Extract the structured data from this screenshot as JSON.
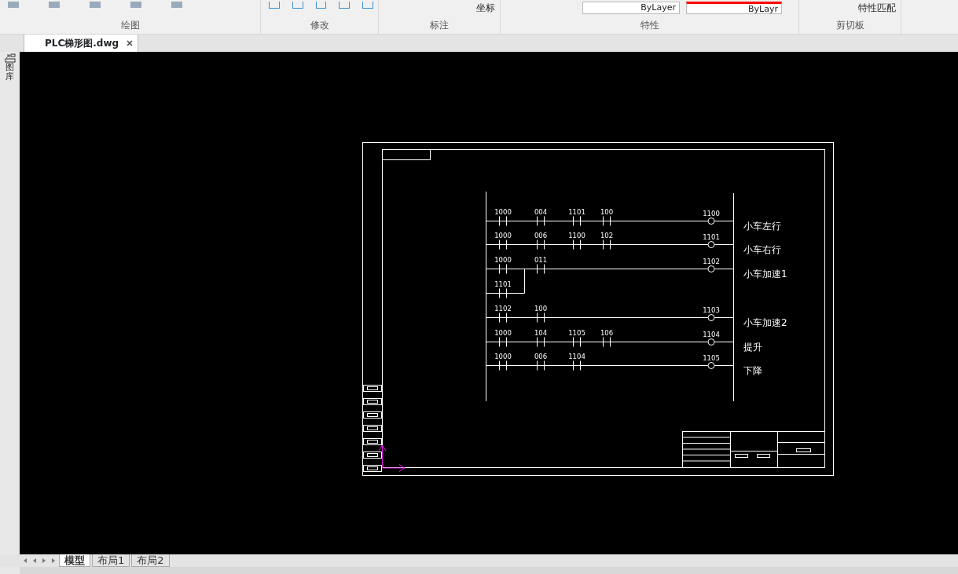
{
  "ribbon": {
    "partial_texts": [
      {
        "kind": "dropdown",
        "text": "坐标"
      },
      {
        "kind": "combo",
        "text": "ByLayer"
      },
      {
        "kind": "color_combo",
        "text": "ByLayr"
      },
      {
        "kind": "tool",
        "text": "特性匹配"
      }
    ],
    "groups": [
      "绘图",
      "修改",
      "标注",
      "特性",
      "剪切板"
    ]
  },
  "file_tabs": [
    {
      "label": "PLC梯形图.dwg",
      "selected": true
    }
  ],
  "side_panel": {
    "label": "图库"
  },
  "drawing": {
    "rungs": [
      {
        "contacts": [
          "1000",
          "004",
          "1101",
          "100"
        ],
        "coil": "1100",
        "name": "小车左行"
      },
      {
        "contacts": [
          "1000",
          "006",
          "1100",
          "102"
        ],
        "coil": "1101",
        "name": "小车右行"
      },
      {
        "contacts": [
          "1000",
          "011"
        ],
        "branch": "1101",
        "coil": "1102",
        "name": "小车加速1"
      },
      {
        "contacts": [
          "1102",
          "100"
        ],
        "coil": "1103",
        "name": "小车加速2"
      },
      {
        "contacts": [
          "1000",
          "104",
          "1105",
          "106"
        ],
        "coil": "1104",
        "name": "提升"
      },
      {
        "contacts": [
          "1000",
          "006",
          "1104"
        ],
        "coil": "1105",
        "name": "下降"
      }
    ]
  },
  "layout_tabs": [
    {
      "label": "模型",
      "selected": true
    },
    {
      "label": "布局1",
      "selected": false
    },
    {
      "label": "布局2",
      "selected": false
    }
  ]
}
